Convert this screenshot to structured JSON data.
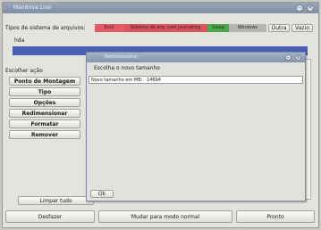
{
  "window": {
    "title": "Mandriva Live"
  },
  "filesystem_types": {
    "label": "Tipos de sistema de arquivos:",
    "segments": [
      {
        "label": "Ext2",
        "color": "#e15a64"
      },
      {
        "label": "Sistema de arq. com Journaling",
        "color": "#d9545e"
      },
      {
        "label": "Swap",
        "color": "#4ca84c"
      },
      {
        "label": "Windows",
        "color": "#b5b5b0"
      }
    ],
    "buttons": [
      "Outra",
      "Vazio"
    ]
  },
  "disk": {
    "tab_label": "hda",
    "bar_color": "#4a5fb4"
  },
  "left_panel": {
    "heading": "Escolher ação",
    "actions": [
      "Ponto de Montagem",
      "Tipo",
      "Opções",
      "Redimensionar",
      "Formatar",
      "Remover"
    ]
  },
  "limpar_label": "Limpar tudo",
  "bottom_buttons": [
    "Desfazer",
    "Mudar para modo normal",
    "Pronto"
  ],
  "dialog": {
    "title": "Redimensionar",
    "heading": "Escolha o novo tamanho",
    "field_label": "Novo tamanho em MB:",
    "field_value": "14694",
    "ok_label": "Ok"
  }
}
